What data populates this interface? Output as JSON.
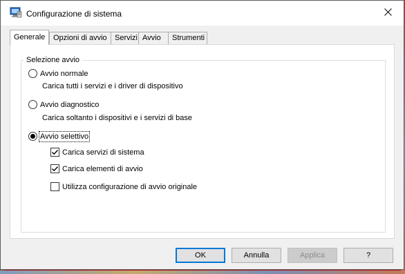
{
  "window": {
    "title": "Configurazione di sistema",
    "icon": "msconfig-icon",
    "close_glyph": "✕"
  },
  "tabs": [
    {
      "label": "Generale",
      "active": true
    },
    {
      "label": "Opzioni di avvio",
      "active": false
    },
    {
      "label": "Servizi",
      "active": false
    },
    {
      "label": "Avvio",
      "active": false
    },
    {
      "label": "Strumenti",
      "active": false
    }
  ],
  "general": {
    "group_title": "Selezione avvio",
    "options": [
      {
        "label": "Avvio normale",
        "description": "Carica tutti i servizi e i driver di dispositivo",
        "selected": false
      },
      {
        "label": "Avvio diagnostico",
        "description": "Carica soltanto i dispositivi e i servizi di base",
        "selected": false
      },
      {
        "label": "Avvio selettivo",
        "selected": true
      }
    ],
    "selective_checks": [
      {
        "label": "Carica servizi di sistema",
        "checked": true
      },
      {
        "label": "Carica elementi di avvio",
        "checked": true
      },
      {
        "label": "Utilizza configurazione di avvio originale",
        "checked": false
      }
    ]
  },
  "buttons": {
    "ok": "OK",
    "cancel": "Annulla",
    "apply": "Applica",
    "help": "?"
  },
  "colors": {
    "accent": "#0078d7",
    "window_bg": "#f0f0f0",
    "panel_bg": "#ffffff"
  }
}
